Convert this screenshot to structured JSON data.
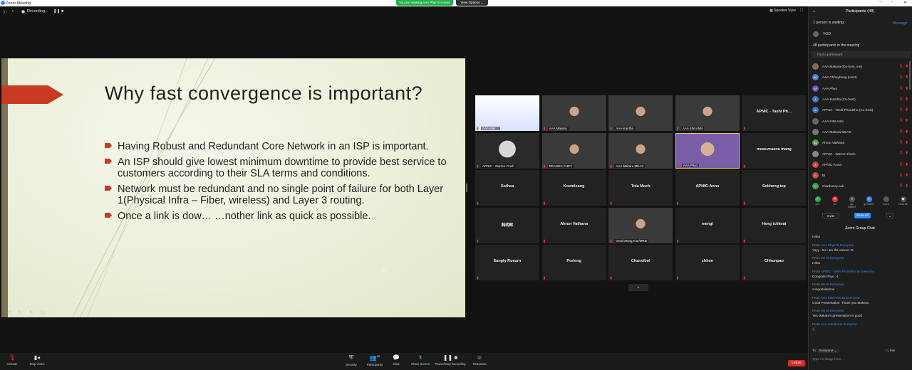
{
  "window": {
    "title": "Zoom Meeting"
  },
  "share_banner": {
    "text": "You are viewing AAA Phyo's screen",
    "view_options": "View Options ⌄"
  },
  "recording": {
    "label": "Recording..."
  },
  "speaker_view": {
    "label": "Speaker View"
  },
  "slide": {
    "title": "Why fast convergence is important?",
    "bullets": [
      "Having Robust and Redundant Core Network in an ISP is important.",
      "An ISP should give lowest minimum downtime to provide best service to customers according to their SLA terms and conditions.",
      "Network must be redundant and no single point of failure for both Layer 1(Physical Infra – Fiber, wireless) and Layer 3 routing.",
      "Once a link is dow…                …nother link as quick as possible."
    ]
  },
  "gallery": [
    {
      "name": "",
      "label": "AAA Mak…",
      "kind": "poster"
    },
    {
      "name": "",
      "label": "AAA Makara",
      "kind": "video"
    },
    {
      "name": "",
      "label": "AAA-Kantha",
      "kind": "video"
    },
    {
      "name": "",
      "label": "AAA KIM ANN",
      "kind": "video"
    },
    {
      "name": "APNIC - Tashi Ph…",
      "label": "",
      "kind": "name"
    },
    {
      "name": "",
      "label": "APNIC - Warren Finch",
      "kind": "avatar"
    },
    {
      "name": "",
      "label": "REAMEA CHEY",
      "kind": "video"
    },
    {
      "name": "",
      "label": "AAA Makara MEAS",
      "kind": "video"
    },
    {
      "name": "",
      "label": "AAA Phyo",
      "kind": "active"
    },
    {
      "name": "measveasna mang",
      "label": "",
      "kind": "name"
    },
    {
      "name": "Sothea",
      "label": "",
      "kind": "name"
    },
    {
      "name": "Koemleang",
      "label": "",
      "kind": "name"
    },
    {
      "name": "Tola Moch",
      "label": "",
      "kind": "name"
    },
    {
      "name": "APNIC-Anna",
      "label": "",
      "kind": "name"
    },
    {
      "name": "Sokheng tep",
      "label": "",
      "kind": "name"
    },
    {
      "name": "韩明辉",
      "label": "",
      "kind": "name"
    },
    {
      "name": "Ahrun Vathana",
      "label": "",
      "kind": "name"
    },
    {
      "name": "",
      "label": "VuochHong Kim/MRD",
      "kind": "video"
    },
    {
      "name": "mengl",
      "label": "",
      "kind": "name"
    },
    {
      "name": "Heng ichkeat",
      "label": "",
      "kind": "name"
    },
    {
      "name": "Eangly Roeurn",
      "label": "",
      "kind": "name"
    },
    {
      "name": "Porleng",
      "label": "",
      "kind": "name"
    },
    {
      "name": "Chanvibol",
      "label": "",
      "kind": "name"
    },
    {
      "name": "chhen",
      "label": "",
      "kind": "name"
    },
    {
      "name": "Chhunpao",
      "label": "",
      "kind": "name"
    }
  ],
  "toolbar": {
    "unmute": "Unmute",
    "stop_video": "Stop Video",
    "security": "Security",
    "participants": "Participants",
    "participants_count": "48",
    "chat": "Chat",
    "share_screen": "Share Screen",
    "pause_recording": "Pause/Stop Recording",
    "reactions": "Reactions",
    "leave": "Leave"
  },
  "participants_panel": {
    "title": "Participants (48)",
    "waiting": "1 person is waiting",
    "message": "Message",
    "waiting_name": "VGO",
    "in_meeting": "48 participants in the meeting",
    "search_placeholder": "Find a participant",
    "list": [
      {
        "name": "AAA Makara (Co-host, me)",
        "initials": "",
        "color": "#8a6a55"
      },
      {
        "name": "AAA Chhayheng (Host)",
        "initials": "AC",
        "color": "#4a7ec2"
      },
      {
        "name": "AAA Phyo",
        "initials": "AP",
        "color": "#7a4ac2"
      },
      {
        "name": "AAA-Kantha (Co-host)",
        "initials": "A",
        "color": "#3a7ac2"
      },
      {
        "name": "APNIC - Tashi Phuntsho (Co-host)",
        "initials": "A",
        "color": "#3a7ac2"
      },
      {
        "name": "AAA KIM ANN",
        "initials": "",
        "color": "#666"
      },
      {
        "name": "AAA Makara MEAS",
        "initials": "",
        "color": "#777"
      },
      {
        "name": "Ahrun Vathana",
        "initials": "AV",
        "color": "#4aa24a"
      },
      {
        "name": "APNIC - Warren Finch",
        "initials": "",
        "color": "#888"
      },
      {
        "name": "APNIC-Anna",
        "initials": "A",
        "color": "#c24a4a"
      },
      {
        "name": "BI",
        "initials": "B",
        "color": "#c24a3a"
      },
      {
        "name": "chanborey.ouk",
        "initials": "C",
        "color": "#3aa24a"
      }
    ],
    "reactions": [
      "yes",
      "no",
      "go slower",
      "go faster",
      "more",
      "clear all"
    ],
    "invite": "Invite",
    "mute_all": "Mute All",
    "more": "⌄"
  },
  "chat": {
    "title": "Zoom Group Chat",
    "messages": [
      {
        "from": "",
        "to": "",
        "text": "Haha"
      },
      {
        "from": "AAA Phyo",
        "to": "Everyone",
        "text": "Yayy.. So I am the winner :D"
      },
      {
        "from": "Me",
        "to": "Everyone",
        "text": "Haha"
      },
      {
        "from": "APNIC - Tashi Phuntsho",
        "to": "Everyone",
        "text": "Congrats Phyo :-)"
      },
      {
        "from": "Me",
        "to": "Everyone",
        "text": "congratulations"
      },
      {
        "from": "AAA KIM ANN",
        "to": "Everyone",
        "text": "Good Presentation. Thank you Makara."
      },
      {
        "from": "Me",
        "to": "Everyone",
        "text": "Yes Makara's presentation is good"
      },
      {
        "from": "AAA-Kantha",
        "to": "Everyone",
        "text": ":)"
      }
    ],
    "to_label": "To:",
    "to_value": "Everyone ⌄",
    "file": "File",
    "placeholder": "Type message here..."
  }
}
